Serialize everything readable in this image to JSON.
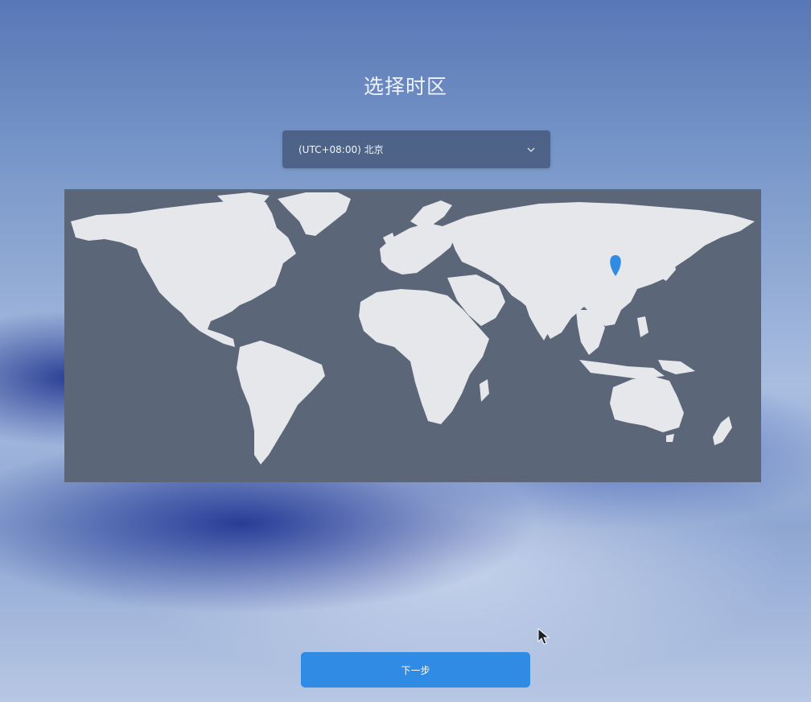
{
  "page": {
    "title": "选择时区"
  },
  "timezone_select": {
    "value": "(UTC+08:00) 北京",
    "icon": "chevron-down-icon"
  },
  "map": {
    "marker_icon": "location-pin-icon",
    "marker_color": "#2f8be3",
    "land_color": "#e6e7ea",
    "ocean_color": "#5b6678"
  },
  "footer": {
    "next_label": "下一步",
    "next_color": "#2f8be3"
  }
}
